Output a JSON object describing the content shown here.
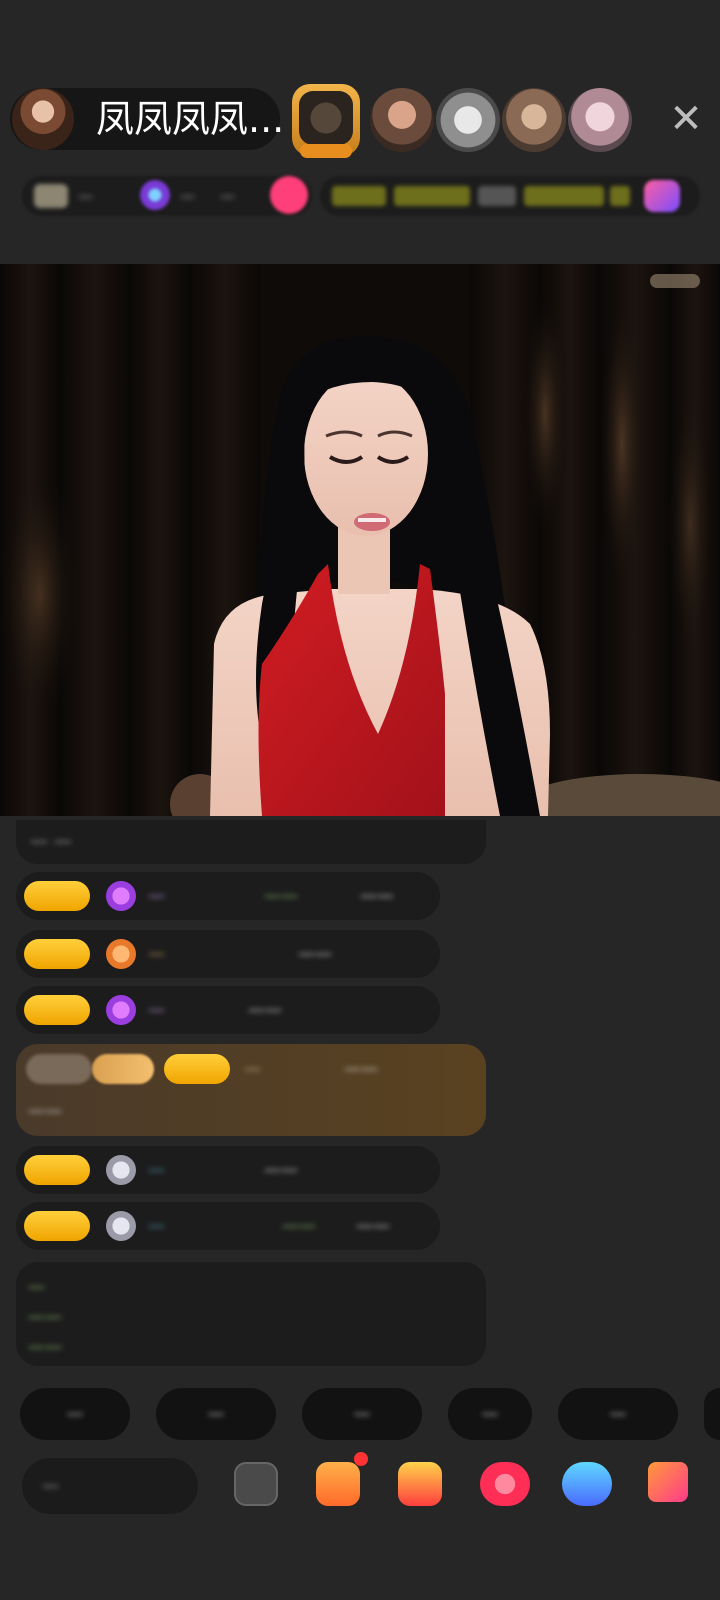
{
  "header": {
    "host_name": "凤凤凤凤...",
    "close_icon": "close-icon"
  },
  "colors": {
    "background": "#262626",
    "badge_gold": "#f7b500",
    "chat_green": "#9fd47a",
    "chat_cyan": "#5fb8d8",
    "dress_red": "#c4161c"
  },
  "stats_bar": [
    "—",
    "—",
    "—",
    "—",
    "—",
    "—"
  ],
  "chat": [
    {
      "type": "system",
      "text": "— —"
    },
    {
      "type": "message",
      "text": "—"
    },
    {
      "type": "message",
      "text": "—"
    },
    {
      "type": "message",
      "text": "—"
    },
    {
      "type": "highlight",
      "text": "—"
    },
    {
      "type": "message",
      "text": "—"
    },
    {
      "type": "message",
      "text": "—"
    },
    {
      "type": "notice",
      "text": "—"
    }
  ],
  "quick_chips": [
    "—",
    "—",
    "—",
    "—",
    "—"
  ],
  "input": {
    "placeholder": "—"
  },
  "toolbar_icons": [
    "emoji-icon",
    "gift-box-icon",
    "treasure-icon",
    "heart-icon",
    "game-icon",
    "grid-icon"
  ]
}
